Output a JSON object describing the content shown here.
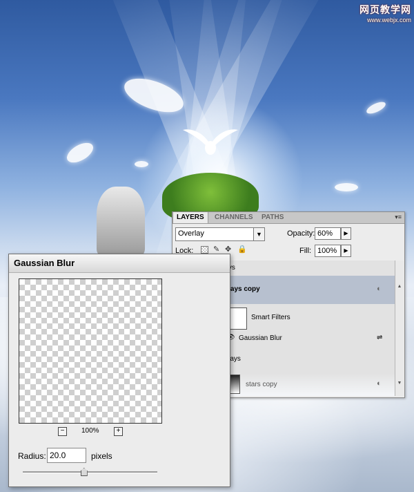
{
  "watermark": {
    "title": "网页教学网",
    "url": "www.webjx.com"
  },
  "layers_panel": {
    "tabs": [
      {
        "label": "LAYERS",
        "active": true
      },
      {
        "label": "CHANNELS",
        "active": false
      },
      {
        "label": "PATHS",
        "active": false
      }
    ],
    "blend_mode": "Overlay",
    "opacity_label": "Opacity:",
    "opacity_value": "60%",
    "lock_label": "Lock:",
    "fill_label": "Fill:",
    "fill_value": "100%",
    "layers": {
      "group_name": "rays",
      "rays_copy": "rays copy",
      "smart_filters": "Smart Filters",
      "gaussian_blur": "Gaussian Blur",
      "rays": "rays",
      "stars_copy": "stars copy"
    }
  },
  "gaussian_blur_dialog": {
    "title": "Gaussian Blur",
    "zoom": "100%",
    "radius_label": "Radius:",
    "radius_value": "20.0",
    "unit": "pixels",
    "slider_fraction": 0.45
  },
  "colors": {
    "selected_row": "#b7c0cf",
    "panel_bg": "#ececec"
  }
}
